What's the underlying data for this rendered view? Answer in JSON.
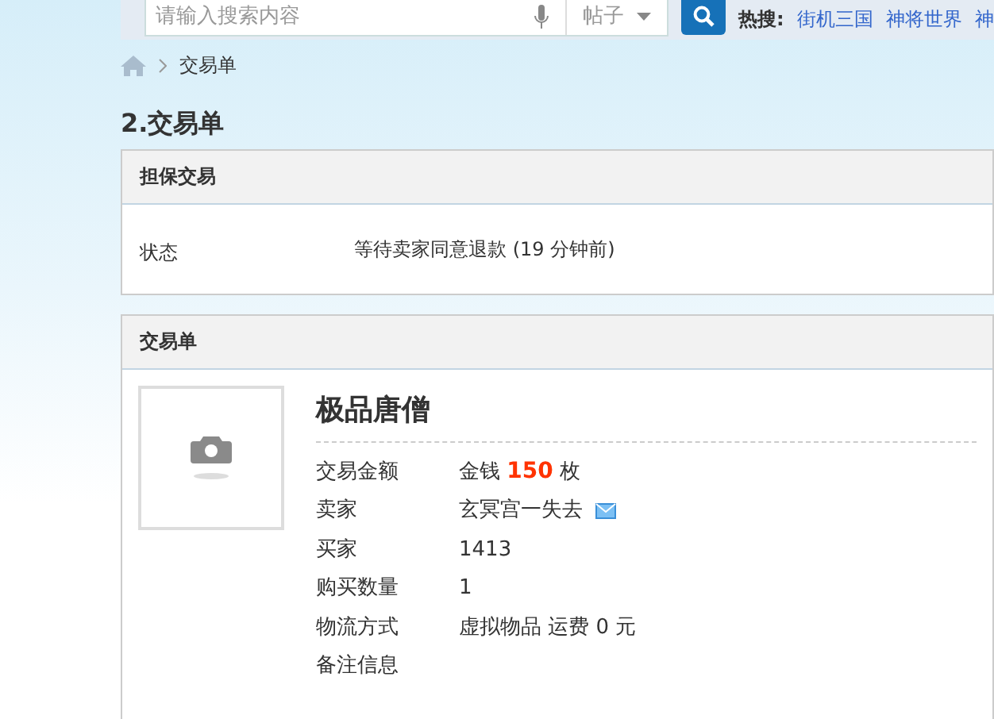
{
  "search": {
    "placeholder": "请输入搜索内容",
    "scope": "帖子"
  },
  "hot_search": {
    "label": "热搜:",
    "links": [
      "街机三国",
      "神将世界",
      "神"
    ]
  },
  "breadcrumb": [
    "交易单"
  ],
  "page_title": "2.交易单",
  "escrow": {
    "header": "担保交易",
    "rows": [
      {
        "label": "状态",
        "value": "等待卖家同意退款 (19 分钟前)"
      }
    ]
  },
  "order": {
    "header": "交易单",
    "product": "极品唐僧",
    "rows": [
      {
        "label": "交易金额",
        "value": "金钱 **150** 枚",
        "mail_icon": false
      },
      {
        "label": "卖家",
        "value": "玄冥宫一失去",
        "mail_icon": true
      },
      {
        "label": "买家",
        "value": "1413",
        "mail_icon": false
      },
      {
        "label": "购买数量",
        "value": "1",
        "mail_icon": false
      },
      {
        "label": "物流方式",
        "value": "虚拟物品 运费 0 元",
        "mail_icon": false
      },
      {
        "label": "备注信息",
        "mail_icon": false
      }
    ]
  }
}
